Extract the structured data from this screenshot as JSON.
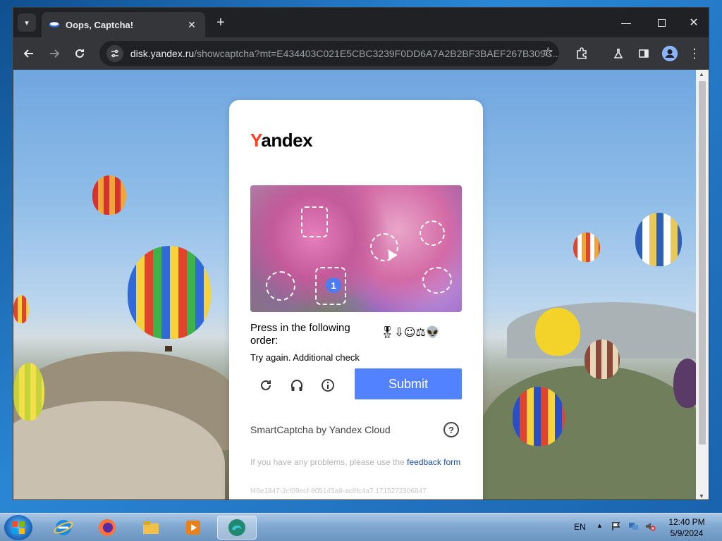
{
  "browser": {
    "tab_title": "Oops, Captcha!",
    "new_tab_symbol": "+",
    "url_host": "disk.yandex.ru",
    "url_path": "/showcaptcha?mt=E434403C021E5CBC3239F0DD6A7A2B2BF3BAEF267B309C..."
  },
  "captcha": {
    "logo_first_letter": "Y",
    "logo_rest": "andex",
    "badge_number": "1",
    "instruction": "Press in the following order:",
    "order_icons": "🎖⇩☺⚖👽",
    "status_message": "Try again. Additional check",
    "submit_label": "Submit",
    "brand_line": "SmartCaptcha by Yandex Cloud",
    "help_symbol": "?",
    "feedback_prefix": "If you have any problems, please use the ",
    "feedback_link": "feedback form",
    "request_id": "f46e1847-2cf09ecf-805145a9-ac8fc4a7.1715272306847"
  },
  "taskbar": {
    "language": "EN",
    "time": "12:40 PM",
    "date": "5/9/2024"
  },
  "colors": {
    "accent_button": "#5282ff",
    "logo_red": "#fc3f1d",
    "badge_blue": "#4d7cf2",
    "link_blue": "#1f4fa8"
  }
}
